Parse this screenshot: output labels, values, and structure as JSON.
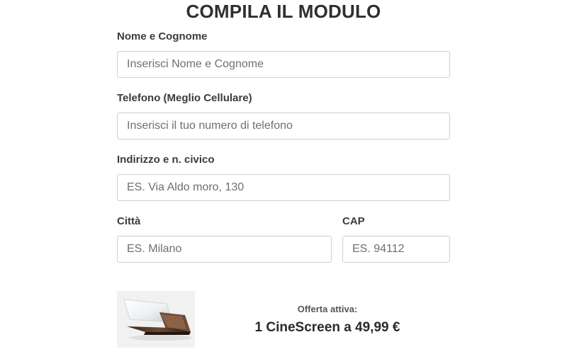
{
  "form": {
    "title": "COMPILA IL MODULO",
    "fields": {
      "name": {
        "label": "Nome e Cognome",
        "placeholder": "Inserisci Nome e Cognome",
        "value": ""
      },
      "phone": {
        "label": "Telefono (Meglio Cellulare)",
        "placeholder": "Inserisci il tuo numero di telefono",
        "value": ""
      },
      "address": {
        "label": "Indirizzo e n. civico",
        "placeholder": "ES. Via Aldo moro, 130",
        "value": ""
      },
      "city": {
        "label": "Città",
        "placeholder": "ES. Milano",
        "value": ""
      },
      "zip": {
        "label": "CAP",
        "placeholder": "ES. 94112",
        "value": ""
      }
    }
  },
  "offer": {
    "image_alt": "product-image",
    "label": "Offerta attiva:",
    "text": "1 CineScreen a 49,99 €"
  }
}
